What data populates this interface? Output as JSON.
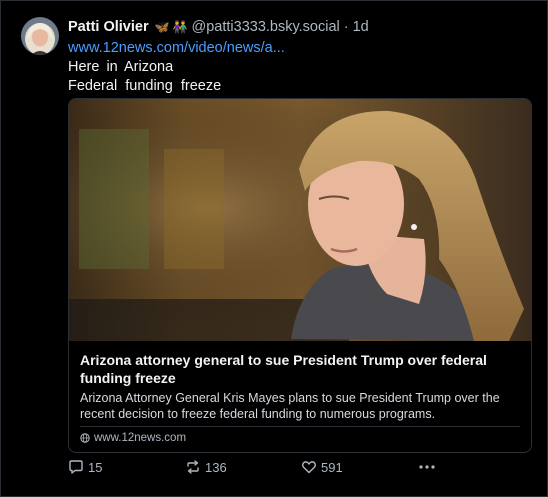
{
  "post": {
    "author": {
      "display_name": "Patti Olivier",
      "emojis": [
        "🦋",
        "👫"
      ],
      "handle": "@patti3333.bsky.social",
      "separator": "·",
      "timestamp": "1d"
    },
    "link_text": "www.12news.com/video/news/a...",
    "lines": [
      "Here in Arizona",
      "Federal  funding  freeze"
    ],
    "card": {
      "title": "Arizona attorney general to sue President Trump over federal funding freeze",
      "description": "Arizona Attorney General Kris Mayes plans to sue President Trump over the recent decision to freeze federal funding to numerous programs.",
      "domain": "www.12news.com"
    },
    "actions": {
      "replies": "15",
      "reposts": "136",
      "likes": "591"
    }
  },
  "colors": {
    "background": "#000000",
    "link": "#4b9eff",
    "muted": "#aeb7c2",
    "border": "#2b2f36"
  },
  "icons": [
    "reply-icon",
    "repost-icon",
    "like-icon",
    "more-icon",
    "globe-icon"
  ]
}
